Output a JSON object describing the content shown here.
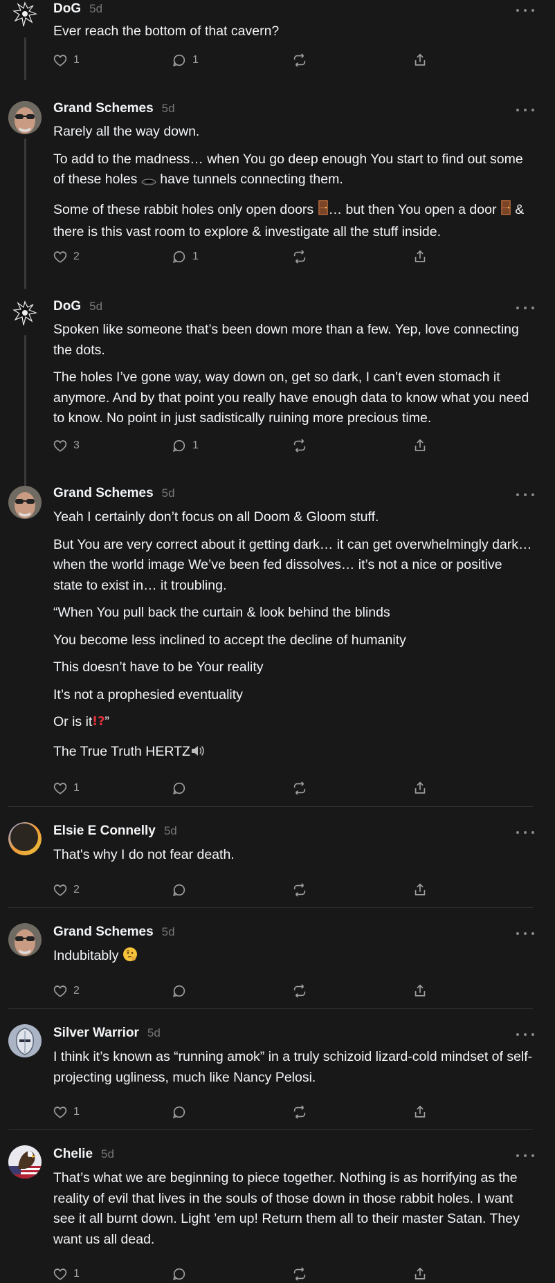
{
  "posts": [
    {
      "author": "DoG",
      "time": "5d",
      "avatar": "spiky-figure",
      "paragraphs": [
        "Ever reach the bottom of that cavern?"
      ],
      "likes": "1",
      "replies": "1"
    },
    {
      "author": "Grand Schemes",
      "time": "5d",
      "avatar": "man-sunglasses",
      "paragraphs": [
        "Rarely all the way down.",
        "To add to the madness… when You go deep enough You start to find out some of these holes",
        "have tunnels connecting them.",
        "Some of these rabbit holes only open doors",
        "… but then You open a door",
        "& there is this vast room to explore & investigate all the stuff inside."
      ],
      "likes": "2",
      "replies": "1"
    },
    {
      "author": "DoG",
      "time": "5d",
      "avatar": "spiky-figure",
      "paragraphs": [
        "Spoken like someone that’s been down more than a few. Yep, love connecting the dots.",
        "The holes I’ve gone way, way down on, get so dark, I can’t even stomach it anymore. And by that point you really have enough data to know what you need to know. No point in just sadistically ruining more precious time."
      ],
      "likes": "3",
      "replies": "1"
    },
    {
      "author": "Grand Schemes",
      "time": "5d",
      "avatar": "man-sunglasses",
      "paragraphs": [
        "Yeah I certainly don’t focus on all Doom & Gloom stuff.",
        "But You are very correct about it getting dark… it can get overwhelmingly dark… when the world image We’ve been fed dissolves… it’s not a nice or positive state to exist in… it troubling.",
        "“When You pull back the curtain & look behind the blinds",
        "You become less inclined to accept the decline of humanity",
        "This doesn’t have to be Your reality",
        "It’s not a prophesied eventuality",
        "Or is it",
        "”",
        "The True Truth HERTZ"
      ],
      "likes": "1",
      "replies": ""
    },
    {
      "author": "Elsie E Connelly",
      "time": "5d",
      "avatar": "gradient-circle",
      "paragraphs": [
        "That's why I do not fear death."
      ],
      "likes": "2",
      "replies": ""
    },
    {
      "author": "Grand Schemes",
      "time": "5d",
      "avatar": "man-sunglasses",
      "paragraphs": [
        "Indubitably"
      ],
      "likes": "2",
      "replies": ""
    },
    {
      "author": "Silver Warrior",
      "time": "5d",
      "avatar": "silver-helmet",
      "paragraphs": [
        "I think it’s known as “running amok” in a truly schizoid lizard-cold mindset of self-projecting ugliness, much like Nancy Pelosi."
      ],
      "likes": "1",
      "replies": ""
    },
    {
      "author": "Chelie",
      "time": "5d",
      "avatar": "eagle-flag",
      "paragraphs": [
        "That’s what we are beginning to piece together. Nothing is as horrifying as the reality of evil that lives in the souls of those down in those rabbit holes. I want see it all burnt down. Light ’em up! Return them all to their master Satan. They want us all dead."
      ],
      "likes": "1",
      "replies": ""
    }
  ],
  "colors": {
    "background": "#181819",
    "text": "#f3f5f7",
    "muted": "#777777",
    "divider": "#2e2e30",
    "threadLine": "#3a3a3c"
  },
  "icons": [
    "heart-icon",
    "comment-icon",
    "repost-icon",
    "share-icon",
    "more-icon"
  ]
}
